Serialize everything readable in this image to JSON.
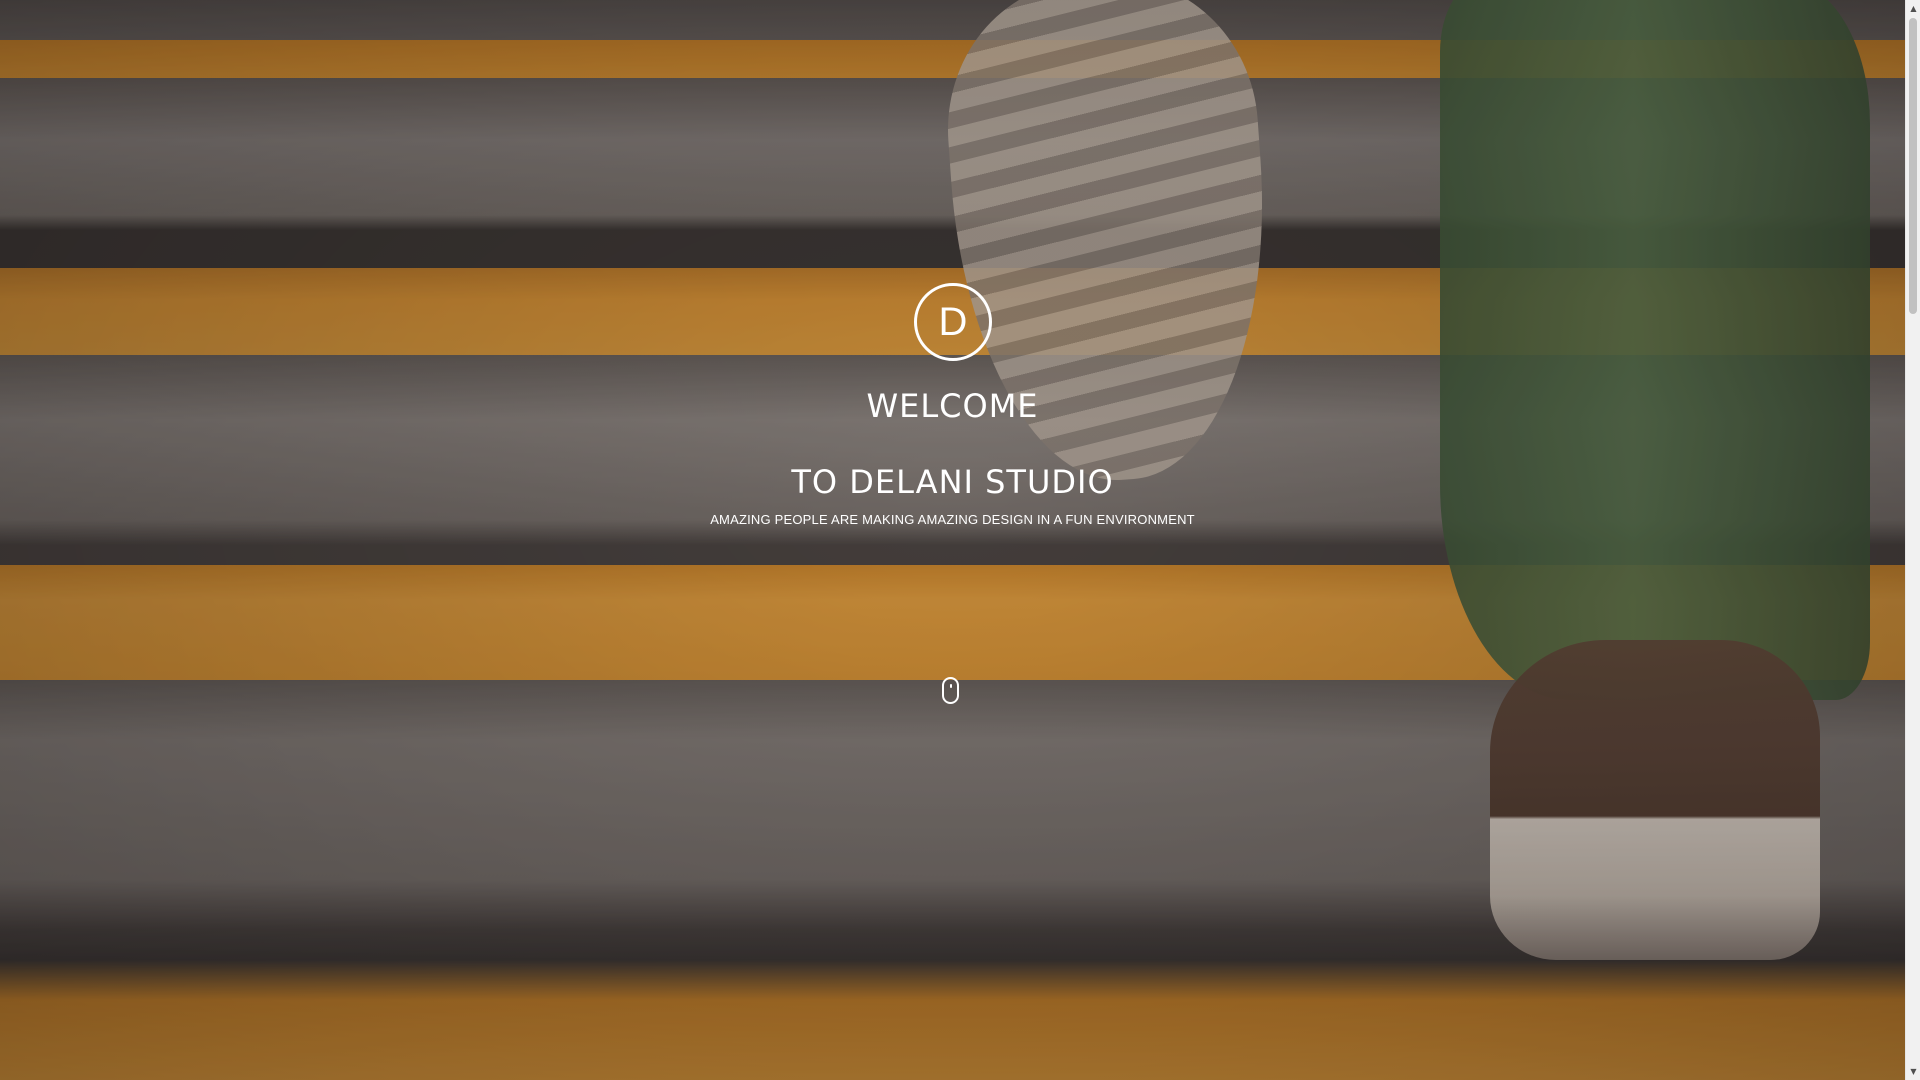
{
  "hero": {
    "logo_letter": "D",
    "headline_1": "WELCOME",
    "headline_2": "TO DELANI STUDIO",
    "tagline": "AMAZING PEOPLE ARE MAKING AMAZING DESIGN IN A FUN ENVIRONMENT",
    "background_icon": "stairs-photo",
    "scroll_icon": "mouse-scroll-icon"
  },
  "colors": {
    "text": "#ffffff",
    "stripe_accent": "#e39a35",
    "step_grey": "#7e7872",
    "scrollbar_track": "#f1f1f1",
    "scrollbar_thumb": "#c1c1c1"
  },
  "scrollbar": {
    "up_arrow": "▲",
    "down_arrow": "▼"
  }
}
